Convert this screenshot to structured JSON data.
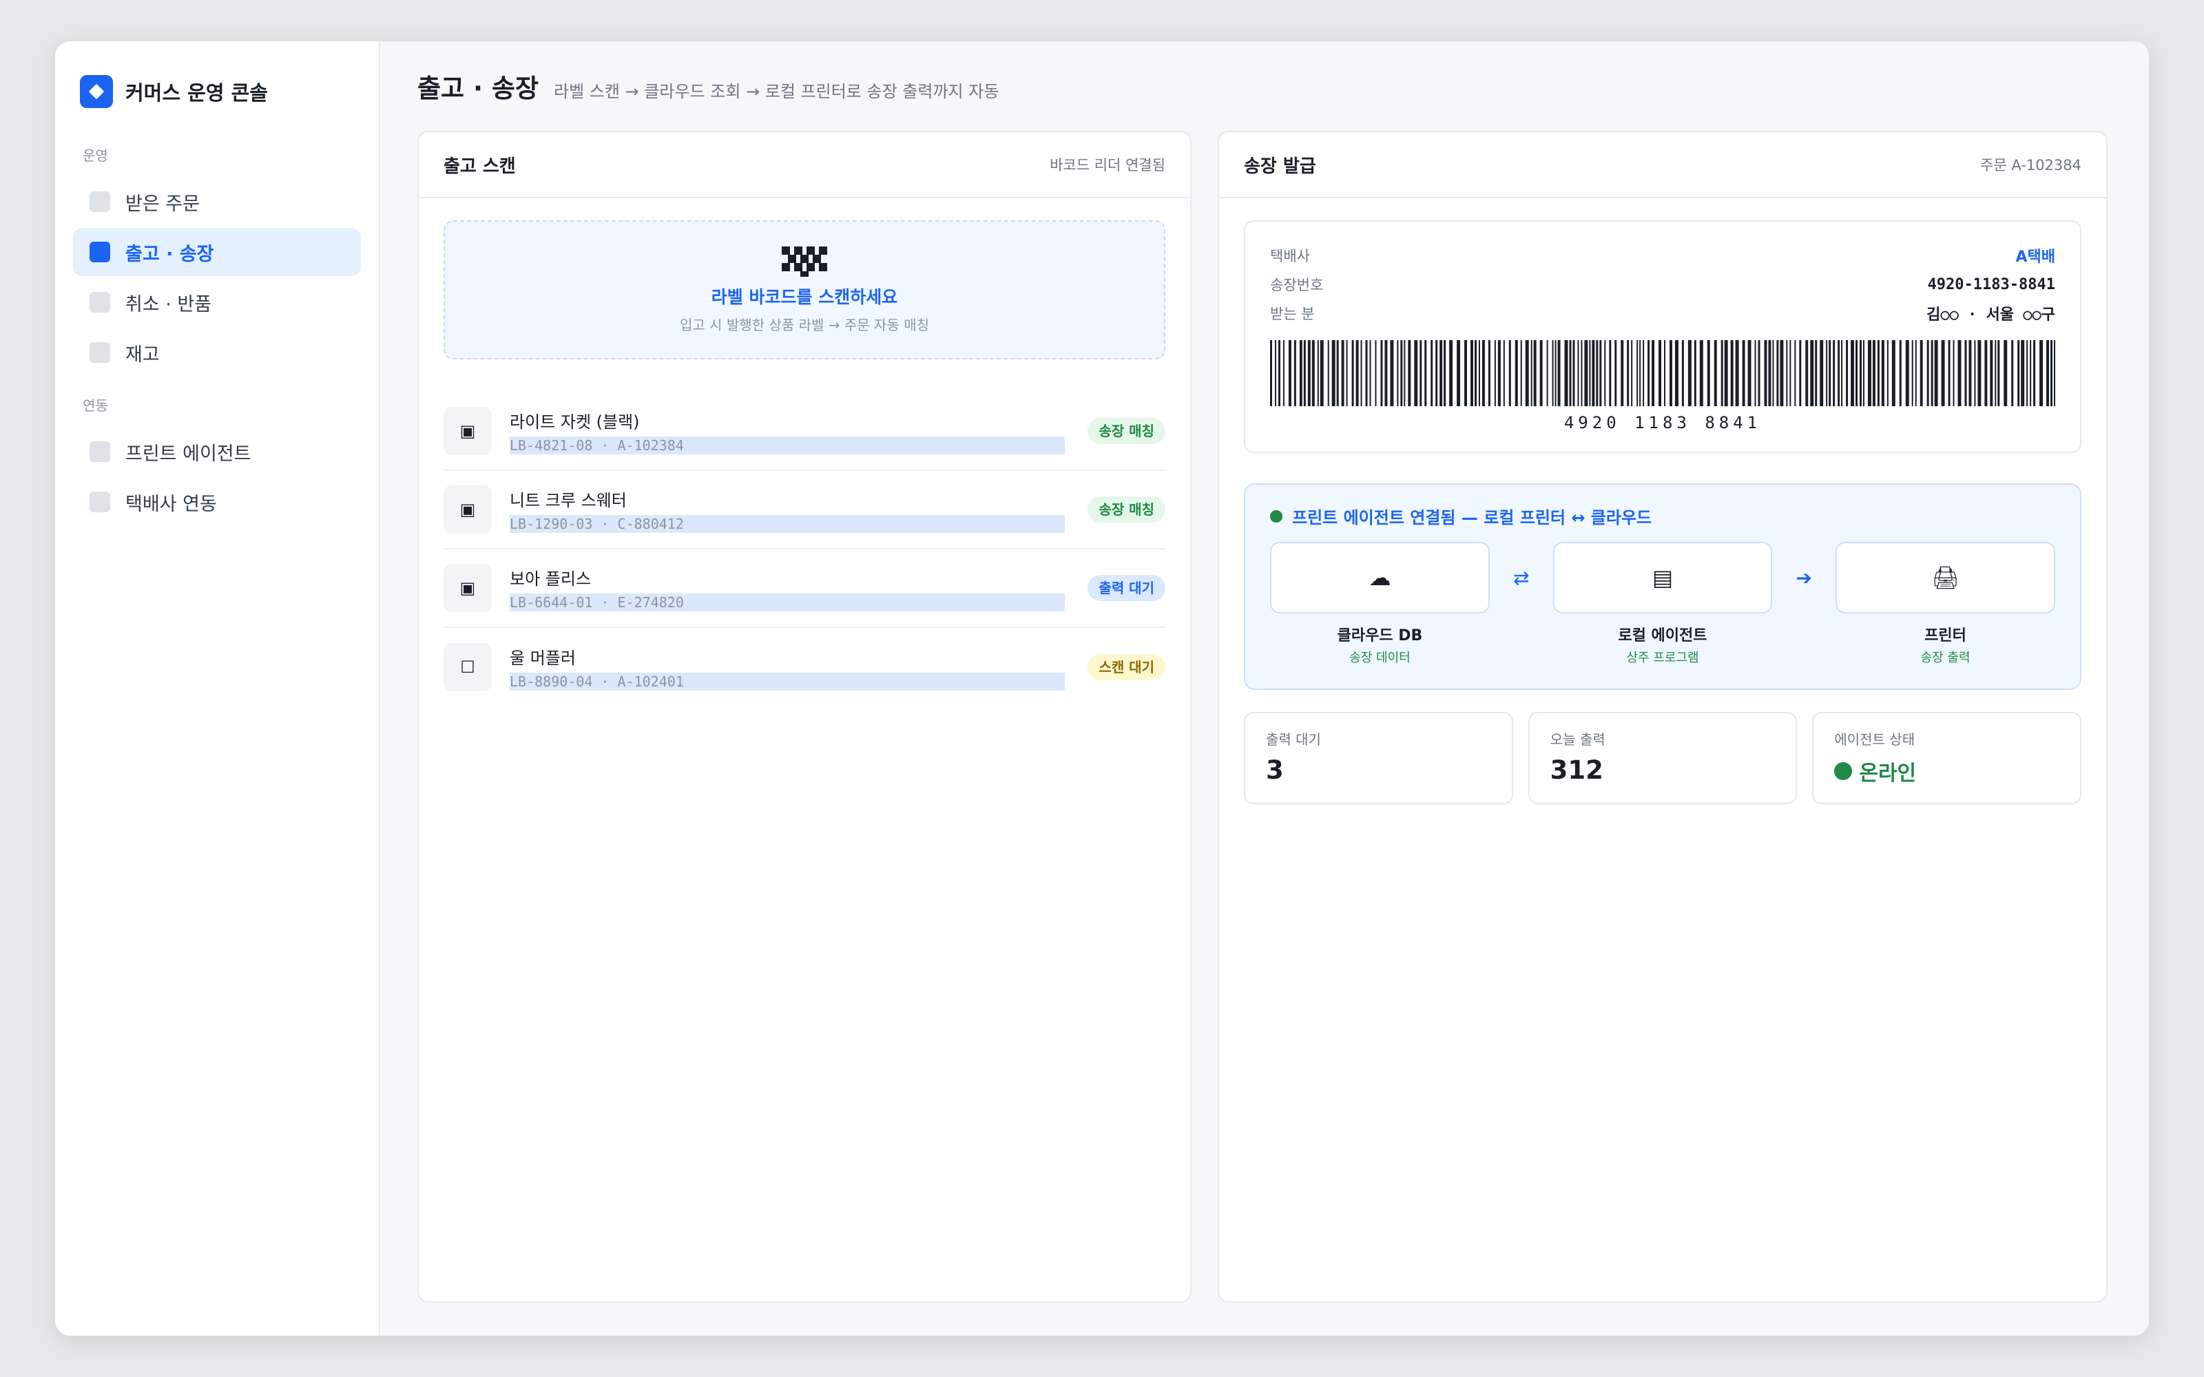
{
  "app": {
    "title": "커머스 운영 콘솔"
  },
  "sidebar": {
    "sections": [
      {
        "label": "운영",
        "items": [
          {
            "label": "받은 주문",
            "active": false
          },
          {
            "label": "출고 · 송장",
            "active": true
          },
          {
            "label": "취소 · 반품",
            "active": false
          },
          {
            "label": "재고",
            "active": false
          }
        ]
      },
      {
        "label": "연동",
        "items": [
          {
            "label": "프린트 에이전트",
            "active": false
          },
          {
            "label": "택배사 연동",
            "active": false
          }
        ]
      }
    ]
  },
  "page": {
    "title": "출고 · 송장",
    "subtitle": "라벨 스캔 → 클라우드 조회 → 로컬 프린터로 송장 출력까지 자동"
  },
  "scan_panel": {
    "title": "출고 스캔",
    "meta": "바코드 리더 연결됨",
    "prompt_title": "라벨 바코드를 스캔하세요",
    "prompt_hint": "입고 시 발행한 상품 라벨 → 주문 자동 매칭",
    "items": [
      {
        "name": "라이트 자켓 (블랙)",
        "code": "LB-4821-08 · A-102384",
        "status": "송장 매칭",
        "status_color": "green",
        "icon": "▣"
      },
      {
        "name": "니트 크루 스웨터",
        "code": "LB-1290-03 · C-880412",
        "status": "송장 매칭",
        "status_color": "green",
        "icon": "▣"
      },
      {
        "name": "보아 플리스",
        "code": "LB-6644-01 · E-274820",
        "status": "출력 대기",
        "status_color": "blue",
        "icon": "▣"
      },
      {
        "name": "울 머플러",
        "code": "LB-8890-04 · A-102401",
        "status": "스캔 대기",
        "status_color": "yellow",
        "icon": "☐"
      }
    ]
  },
  "invoice_panel": {
    "title": "송장 발급",
    "meta": "주문 A-102384",
    "carrier_label": "택배사",
    "carrier_value": "A택배",
    "tracking_label": "송장번호",
    "tracking_value": "4920-1183-8841",
    "recipient_label": "받는 분",
    "recipient_value": "김○○ · 서울 ○○구",
    "barcode_text": "4920 1183 8841"
  },
  "agent": {
    "status_text": "프린트 에이전트 연결됨 — 로컬 프린터 ↔ 클라우드",
    "nodes": [
      {
        "name": "클라우드 DB",
        "sub": "송장 데이터",
        "icon": "cloud-icon",
        "glyph": "☁"
      },
      {
        "name": "로컬 에이전트",
        "sub": "상주 프로그램",
        "icon": "agent-icon",
        "glyph": "▤"
      },
      {
        "name": "프린터",
        "sub": "송장 출력",
        "icon": "printer-icon",
        "glyph": "🖨"
      }
    ],
    "arrows": [
      "⇄",
      "➔"
    ]
  },
  "stats": [
    {
      "label": "출력 대기",
      "value": "3"
    },
    {
      "label": "오늘 출력",
      "value": "312"
    },
    {
      "label": "에이전트 상태",
      "value": "온라인"
    }
  ],
  "colors": {
    "accent": "#1b64f2",
    "success": "#1e8a44",
    "warning": "#8a6a00"
  }
}
